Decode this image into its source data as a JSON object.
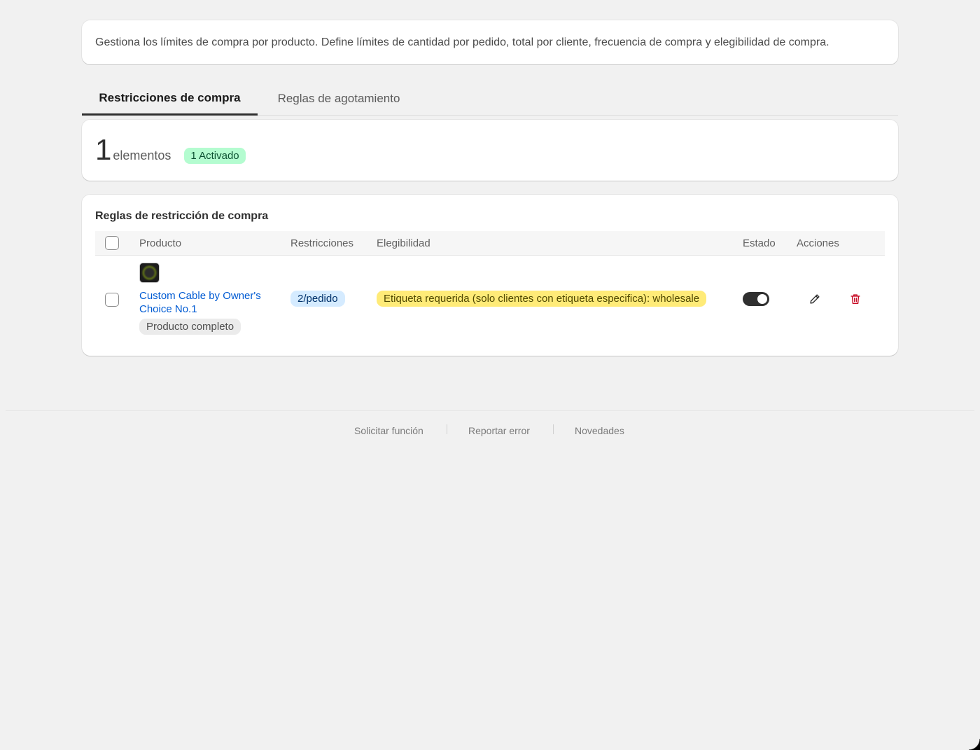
{
  "intro": {
    "text": "Gestiona los límites de compra por producto. Define límites de cantidad por pedido, total por cliente, frecuencia de compra y elegibilidad de compra."
  },
  "tabs": [
    {
      "label": "Restricciones de compra",
      "active": true
    },
    {
      "label": "Reglas de agotamiento",
      "active": false
    }
  ],
  "summary": {
    "count": "1",
    "count_label": "elementos",
    "active_badge": "1 Activado"
  },
  "rules": {
    "title": "Reglas de restricción de compra",
    "columns": [
      "Producto",
      "Restricciones",
      "Elegibilidad",
      "Estado",
      "Acciones"
    ],
    "rows": [
      {
        "product_name": "Custom Cable by Owner's Choice No.1",
        "scope": "Producto completo",
        "restriction": "2/pedido",
        "eligibility": "Etiqueta requerida (solo clientes con etiqueta especifica): wholesale",
        "enabled": true
      }
    ]
  },
  "footer": {
    "links": [
      "Solicitar función",
      "Reportar error",
      "Novedades"
    ]
  },
  "colors": {
    "accent_link": "#005bd3",
    "badge_active_bg": "#b4fcd0",
    "restriction_bg": "#d5ebff",
    "eligibility_bg": "#ffeb78",
    "delete_icon": "#c70a24"
  },
  "icons": [
    "pencil-icon",
    "trash-icon"
  ]
}
